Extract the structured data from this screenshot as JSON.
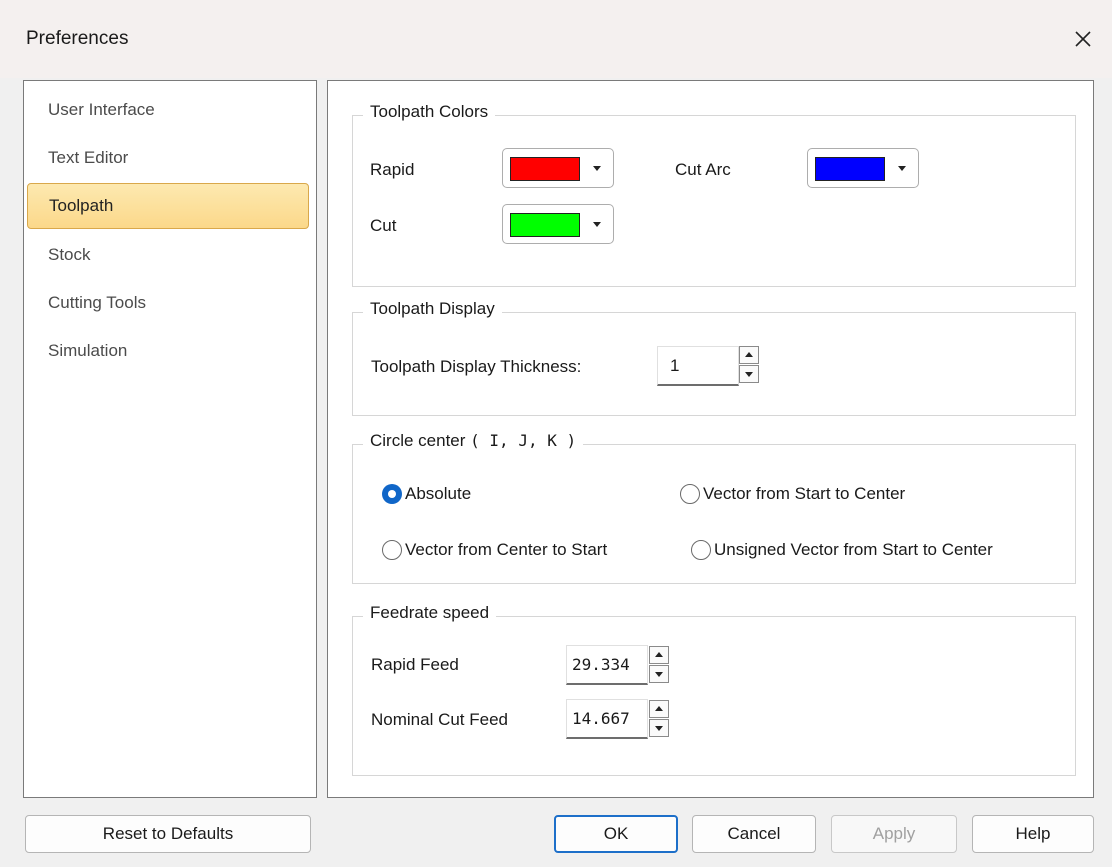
{
  "window": {
    "title": "Preferences"
  },
  "nav": {
    "items": [
      {
        "label": "User Interface"
      },
      {
        "label": "Text Editor"
      },
      {
        "label": "Toolpath"
      },
      {
        "label": "Stock"
      },
      {
        "label": "Cutting Tools"
      },
      {
        "label": "Simulation"
      }
    ],
    "selected": "Toolpath"
  },
  "toolpath_colors": {
    "title": "Toolpath Colors",
    "rapid_label": "Rapid",
    "rapid_color": "#ff0000",
    "cut_label": "Cut",
    "cut_color": "#00ff00",
    "cut_arc_label": "Cut Arc",
    "cut_arc_color": "#0000ff"
  },
  "toolpath_display": {
    "title": "Toolpath Display",
    "thickness_label": "Toolpath Display Thickness:",
    "thickness_value": "1"
  },
  "circle_center": {
    "title_prefix": "Circle center",
    "title_suffix": "( I, J, K )",
    "options": [
      {
        "label": "Absolute",
        "checked": true
      },
      {
        "label": "Vector from Start to Center",
        "checked": false
      },
      {
        "label": "Vector from Center to Start",
        "checked": false
      },
      {
        "label": "Unsigned Vector from Start to Center",
        "checked": false
      }
    ]
  },
  "feedrate": {
    "title": "Feedrate speed",
    "rapid_label": "Rapid Feed",
    "rapid_value": "29.334",
    "nominal_label": "Nominal Cut Feed",
    "nominal_value": "14.667"
  },
  "buttons": {
    "reset": "Reset to Defaults",
    "ok": "OK",
    "cancel": "Cancel",
    "apply": "Apply",
    "help": "Help"
  },
  "colors": {
    "accent": "#1066c8",
    "selection_fill": "#fbd88a",
    "selection_border": "#d9a84b"
  }
}
